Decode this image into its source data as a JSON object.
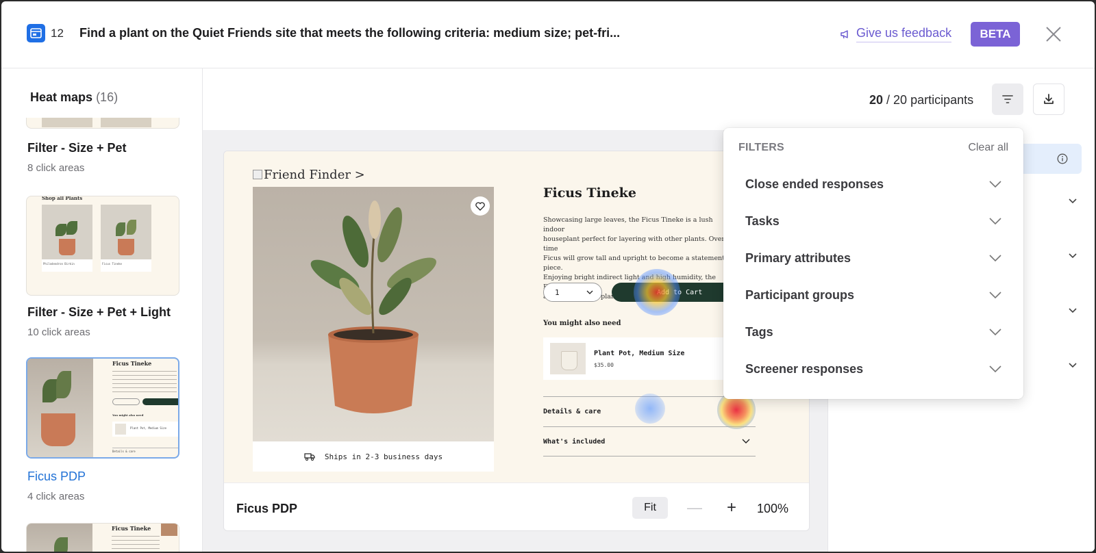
{
  "header": {
    "task_number": "12",
    "task_title": "Find a plant on the Quiet Friends site that meets the following criteria: medium size; pet-fri...",
    "feedback_label": "Give us feedback",
    "beta_label": "BETA"
  },
  "sidebar": {
    "title": "Heat maps",
    "count": "(16)",
    "items": [
      {
        "name": "Filter - Size + Pet",
        "sub": "8 click areas"
      },
      {
        "name": "Filter - Size + Pet + Light",
        "sub": "10 click areas",
        "thumb_heading": "Shop all Plants",
        "thumb_products": [
          "Philodendron Birkin",
          "Ficus Tineke"
        ]
      },
      {
        "name": "Ficus PDP",
        "sub": "4 click areas",
        "thumb_heading": "Ficus Tineke",
        "thumb_section": "You might also need",
        "thumb_product": "Plant Pot, Medium Size",
        "thumb_accordion": "Details & care"
      },
      {
        "thumb_heading": "Ficus Tineke"
      }
    ]
  },
  "toolbar": {
    "participants_count": "20",
    "participants_total": "20 participants"
  },
  "preview": {
    "breadcrumb": "Friend Finder >",
    "product_title": "Ficus Tineke",
    "product_description": "Showcasing large leaves, the Ficus Tineke is a lush indoor\nhouseplant perfect for layering with other plants. Over time\nFicus will grow tall and upright to become a statement piece.\nEnjoying bright indirect light and high humidity, the Ficus Tineke is\nan ideal tabletop plant.",
    "quantity": "1",
    "add_to_cart": "Add to Cart",
    "also_need": "You might also need",
    "related_name": "Plant Pot, Medium Size",
    "related_price": "$35.00",
    "details": "Details & care",
    "included": "What's included",
    "shipping": "Ships in 2-3 business days",
    "footer_title": "Ficus PDP",
    "fit_label": "Fit",
    "minus": "—",
    "plus": "+",
    "zoom": "100%"
  },
  "filters": {
    "heading": "FILTERS",
    "clear_all": "Clear all",
    "rows": [
      "Close ended responses",
      "Tasks",
      "Primary attributes",
      "Participant groups",
      "Tags",
      "Screener responses"
    ]
  },
  "colors": {
    "accent_blue": "#2272d6",
    "beta_purple": "#7b63d6",
    "feedback_purple": "#6a5ad0",
    "cart_green": "#1f3a2e"
  },
  "icons": [
    "task-icon",
    "megaphone-icon",
    "close-icon",
    "filter-icon",
    "download-icon",
    "heart-icon",
    "truck-icon",
    "chevron-down-icon",
    "info-icon"
  ]
}
